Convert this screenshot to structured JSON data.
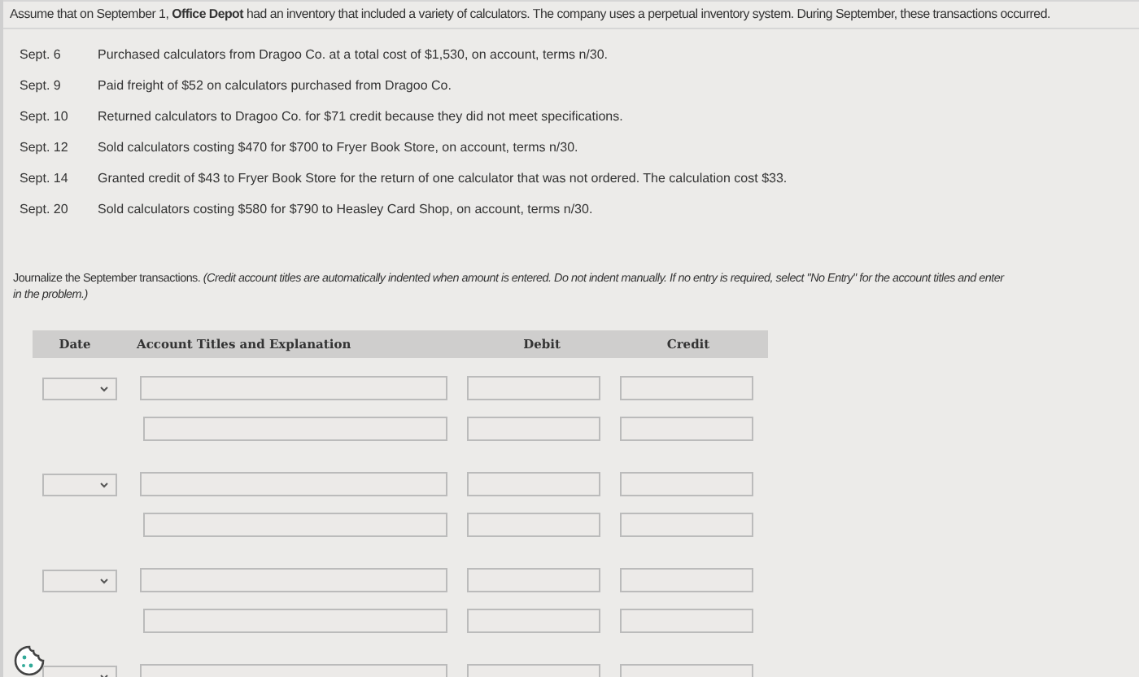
{
  "intro": "Assume that on September 1, **Office Depot** had an inventory that included a variety of calculators. The company uses a perpetual inventory system. During September, these transactions occurred.",
  "transactions": [
    {
      "date": "Sept. 6",
      "text": "Purchased calculators from Dragoo Co. at a total cost of $1,530, on account, terms n/30."
    },
    {
      "date": "Sept. 9",
      "text": "Paid freight of $52 on calculators purchased from Dragoo Co."
    },
    {
      "date": "Sept. 10",
      "text": "Returned calculators to Dragoo Co. for $71 credit because they did not meet specifications."
    },
    {
      "date": "Sept. 12",
      "text": "Sold calculators costing $470 for $700 to Fryer Book Store, on account, terms n/30."
    },
    {
      "date": "Sept. 14",
      "text": "Granted credit of $43 to Fryer Book Store for the return of one calculator that was not ordered. The calculation cost $33."
    },
    {
      "date": "Sept. 20",
      "text": "Sold calculators costing $580 for $790 to Heasley Card Shop, on account, terms n/30."
    }
  ],
  "instruction": [
    "Journalize the September transactions. *(Credit account titles are automatically indented when amount is entered. Do not indent manually. If no entry is required, select \"No Entry\" for the account titles and enter*",
    "*in the problem.)*"
  ],
  "table": {
    "columns": [
      "Date",
      "Account Titles and Explanation",
      "Debit",
      "Credit"
    ],
    "entries": [
      {
        "lines": [
          {
            "kind": "debit"
          },
          {
            "kind": "credit"
          }
        ]
      },
      {
        "lines": [
          {
            "kind": "debit"
          },
          {
            "kind": "credit"
          }
        ]
      },
      {
        "lines": [
          {
            "kind": "debit"
          },
          {
            "kind": "credit"
          }
        ]
      },
      {
        "lines": [
          {
            "kind": "debit"
          }
        ]
      }
    ]
  }
}
